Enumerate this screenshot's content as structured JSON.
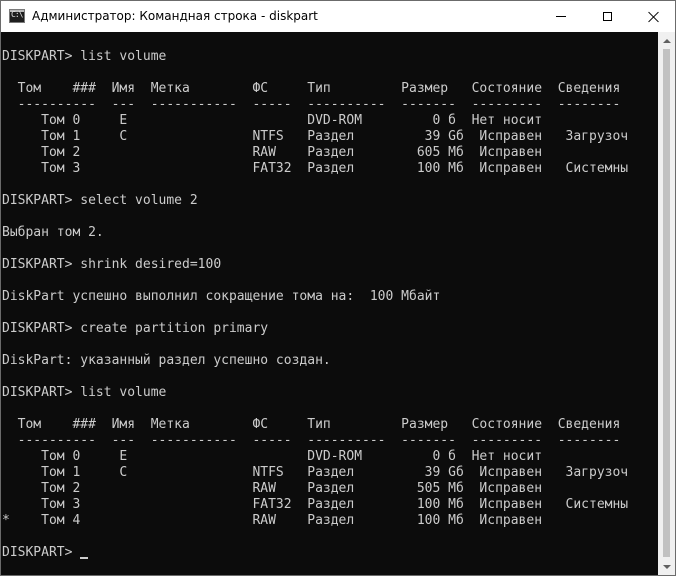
{
  "window": {
    "title": "Администратор: Командная строка - diskpart",
    "icon_text": "C:\\"
  },
  "controls": {
    "minimize": "minimize-icon",
    "maximize": "maximize-icon",
    "close": "close-icon"
  },
  "console": {
    "lines": [
      "DISKPART> list volume",
      "",
      "  Том    ###  Имя  Метка        ФС     Тип         Размер   Состояние  Сведения",
      "  ----------  ---  -----------  -----  ----------  -------  ---------  --------",
      "     Том 0     E                       DVD-ROM         0 б  Нет носит",
      "     Том 1     C                NTFS   Раздел         39 Gб  Исправен   Загрузоч",
      "     Том 2                      RAW    Раздел        605 Мб  Исправен",
      "     Том 3                      FAT32  Раздел        100 Мб  Исправен   Системны",
      "",
      "DISKPART> select volume 2",
      "",
      "Выбран том 2.",
      "",
      "DISKPART> shrink desired=100",
      "",
      "DiskPart успешно выполнил сокращение тома на:  100 Мбайт",
      "",
      "DISKPART> create partition primary",
      "",
      "DiskPart: указанный раздел успешно создан.",
      "",
      "DISKPART> list volume",
      "",
      "  Том    ###  Имя  Метка        ФС     Тип         Размер   Состояние  Сведения",
      "  ----------  ---  -----------  -----  ----------  -------  ---------  --------",
      "     Том 0     E                       DVD-ROM         0 б  Нет носит",
      "     Том 1     C                NTFS   Раздел         39 Gб  Исправен   Загрузоч",
      "     Том 2                      RAW    Раздел        505 Мб  Исправен",
      "     Том 3                      FAT32  Раздел        100 Мб  Исправен   Системны",
      "*    Том 4                      RAW    Раздел        100 Мб  Исправен",
      "",
      "DISKPART> "
    ]
  },
  "colors": {
    "console_bg": "#0c0c0c",
    "console_fg": "#cccccc",
    "titlebar_bg": "#ffffff"
  }
}
